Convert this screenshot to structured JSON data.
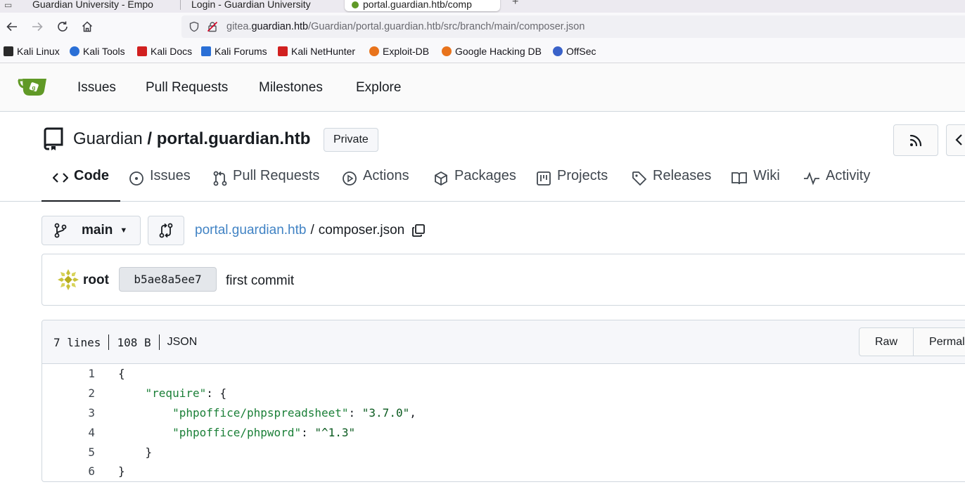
{
  "browser": {
    "tabs": [
      {
        "label": "Guardian University - Empo"
      },
      {
        "label": "Login - Guardian University"
      },
      {
        "label": "portal.guardian.htb/comp"
      }
    ],
    "url_prefix": "gitea.",
    "url_host": "guardian.htb",
    "url_path": "/Guardian/portal.guardian.htb/src/branch/main/composer.json",
    "bookmarks": [
      {
        "label": "Kali Linux",
        "color": "#2a2a2a"
      },
      {
        "label": "Kali Tools",
        "color": "#2a6fd6"
      },
      {
        "label": "Kali Docs",
        "color": "#d12020"
      },
      {
        "label": "Kali Forums",
        "color": "#2a6fd6"
      },
      {
        "label": "Kali NetHunter",
        "color": "#d12020"
      },
      {
        "label": "Exploit-DB",
        "color": "#e8731c"
      },
      {
        "label": "Google Hacking DB",
        "color": "#e8731c"
      },
      {
        "label": "OffSec",
        "color": "#3a62c9"
      }
    ]
  },
  "gitea_nav": {
    "items": [
      "Issues",
      "Pull Requests",
      "Milestones",
      "Explore"
    ]
  },
  "repo": {
    "owner": "Guardian",
    "separator": "/",
    "name": "portal.guardian.htb",
    "visibility": "Private",
    "tabs": [
      "Code",
      "Issues",
      "Pull Requests",
      "Actions",
      "Packages",
      "Projects",
      "Releases",
      "Wiki",
      "Activity"
    ]
  },
  "file_bar": {
    "branch": "main",
    "repo_link": "portal.guardian.htb",
    "sep": "/",
    "filename": "composer.json"
  },
  "commit": {
    "author": "root",
    "sha": "b5ae8a5ee7",
    "message": "first commit"
  },
  "file": {
    "lines_info": "7 lines",
    "size": "108 B",
    "language": "JSON",
    "buttons": [
      "Raw",
      "Permalink"
    ],
    "code": [
      {
        "n": "1",
        "indent": "",
        "key": "",
        "rest": "{"
      },
      {
        "n": "2",
        "indent": "    ",
        "key": "\"require\"",
        "rest": ": {"
      },
      {
        "n": "3",
        "indent": "        ",
        "key": "\"phpoffice/phpspreadsheet\"",
        "rest": ": ",
        "val": "\"3.7.0\"",
        "tail": ","
      },
      {
        "n": "4",
        "indent": "        ",
        "key": "\"phpoffice/phpword\"",
        "rest": ": ",
        "val": "\"^1.3\"",
        "tail": ""
      },
      {
        "n": "5",
        "indent": "    ",
        "key": "",
        "rest": "}"
      },
      {
        "n": "6",
        "indent": "",
        "key": "",
        "rest": "}"
      }
    ]
  }
}
